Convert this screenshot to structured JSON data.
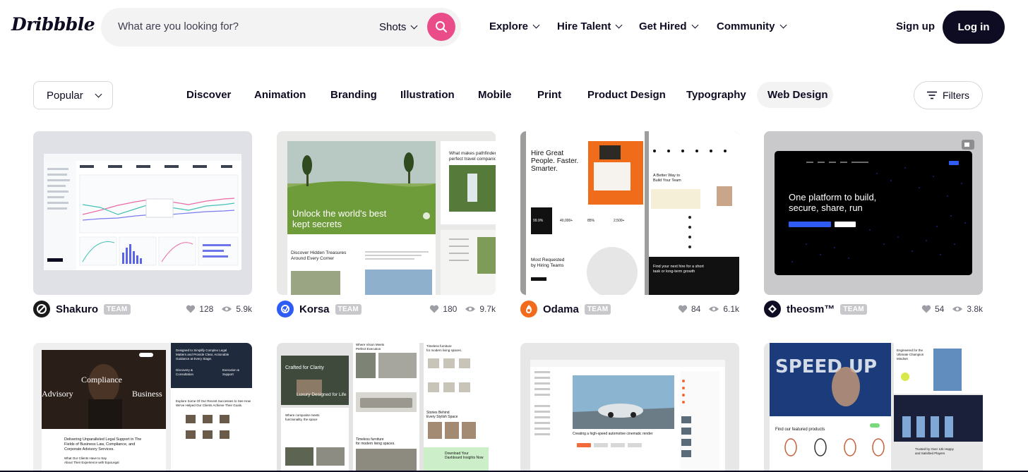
{
  "brand": {
    "logo": "Dribbble",
    "accent": "#ea4c89"
  },
  "search": {
    "placeholder": "What are you looking for?",
    "type": "Shots"
  },
  "nav": {
    "explore": "Explore",
    "hire": "Hire Talent",
    "hired": "Get Hired",
    "community": "Community",
    "signup": "Sign up",
    "login": "Log in"
  },
  "filters": {
    "sort": "Popular",
    "categories": [
      "Discover",
      "Animation",
      "Branding",
      "Illustration",
      "Mobile",
      "Print",
      "Product Design",
      "Typography",
      "Web Design"
    ],
    "active_category": "Web Design",
    "filters_label": "Filters"
  },
  "shots": [
    {
      "author": "Shakuro",
      "badge": "TEAM",
      "likes": "128",
      "views": "5.9k",
      "avatar_color": "#1a1a1a"
    },
    {
      "author": "Korsa",
      "badge": "TEAM",
      "likes": "180",
      "views": "9.7k",
      "avatar_color": "#2f5cf5",
      "texts": {
        "headline": "Unlock the world's best kept secrets",
        "side": "What makes pathfinders perfect travel companions",
        "sub": "Discover Hidden Treasures Around Every Corner"
      }
    },
    {
      "author": "Odama",
      "badge": "TEAM",
      "likes": "84",
      "views": "6.1k",
      "avatar_color": "#f26a1b",
      "texts": {
        "headline": "Hire Great People. Faster. Smarter.",
        "side": "A Better Way to Build Your Team",
        "sub": "Most Requested by Hiring Teams",
        "bottom": "Find your next hire for a short task or long-term growth",
        "stat1": "99.9%",
        "stat2": "40,000+",
        "stat3": "85%",
        "stat4": "2,500+"
      }
    },
    {
      "author": "theosm™",
      "badge": "TEAM",
      "likes": "54",
      "views": "3.8k",
      "avatar_color": "#0d0c22",
      "texts": {
        "headline": "One platform to build, secure, share, run"
      }
    },
    {
      "texts": {
        "title1": "Compliance",
        "left": "Advisory",
        "right": "Business",
        "side": "Designed to Simplify Complex Legal Matters and Provide Clear, Actionable Guidance at Every Stage.",
        "col1": "Discovery & Consultation",
        "col2": "Execution & Support",
        "body": "Explore Some Of Our Recent Successes to See How We've Helped Our Clients Achieve Their Goals.",
        "footer": "Delivering Unparalleled Legal Support in The Fields of Business Law, Compliance, and Corporate Advisory Services.",
        "footer2": "What Our Clients Have to Say About Their Experience with EquiLegal"
      }
    },
    {
      "texts": {
        "title1": "Where Vision Meets Perfect Execution",
        "crafted": "Crafted for Clarity",
        "luxury": "Luxury Designed for Life",
        "timeless": "Timeless furniture for modern living spaces.",
        "stories": "Stories Behind Every Stylish Space",
        "dl": "Download Your Dashboard Insights Now"
      }
    },
    {
      "texts": {
        "caption": "Creating a high-speed automotive cinematic render"
      }
    },
    {
      "texts": {
        "speed": "SPEED UP",
        "engineered": "Engineered for the Ultimate Champion Mindset",
        "featured": "Find our featured products",
        "trusted": "Trusted by Over 12k Happy and Satisfied Players"
      }
    }
  ]
}
